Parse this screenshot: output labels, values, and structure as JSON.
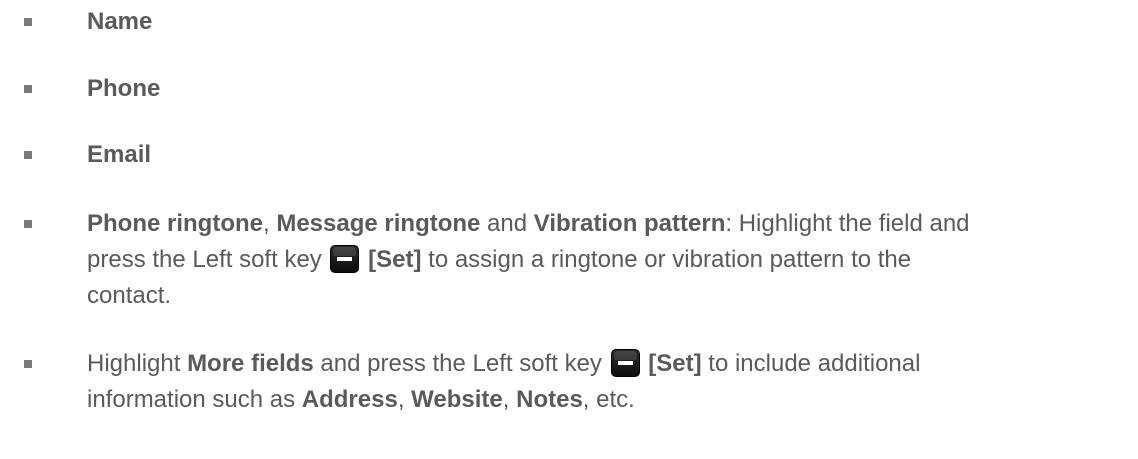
{
  "fields": [
    {
      "label": "Name"
    },
    {
      "label": "Phone"
    },
    {
      "label": "Email"
    }
  ],
  "ringtone_item": {
    "phone_ringtone": "Phone ringtone",
    "sep1": ", ",
    "message_ringtone": "Message ringtone",
    "and": " and ",
    "vibration_pattern": "Vibration pattern",
    "line1_rest": ": Highlight the field and",
    "line2_pre": "press the Left soft key",
    "set_label": "[Set]",
    "line2_post": " to assign a ringtone or vibration pattern to the",
    "line3": "contact."
  },
  "more_item": {
    "highlight": "Highlight ",
    "more_fields": "More fields",
    "mid": " and press the Left soft key",
    "set_label": "[Set]",
    "post": " to include additional",
    "line2_pre": "information such as ",
    "address": "Address",
    "comma1": ", ",
    "website": "Website",
    "comma2": ", ",
    "notes": "Notes",
    "etc": ", etc."
  },
  "icons": {
    "left_soft_key": "left-soft-key-icon"
  }
}
